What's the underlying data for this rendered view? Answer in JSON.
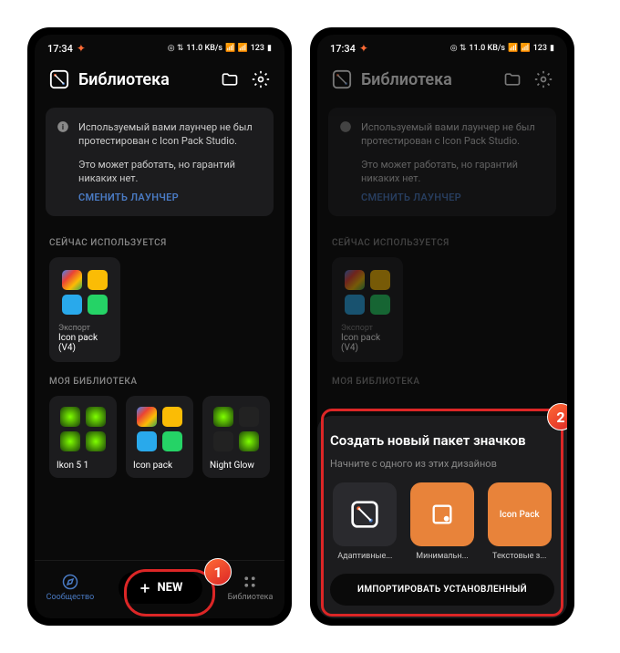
{
  "statusbar": {
    "time": "17:34",
    "speed": "11.0 KB/s",
    "battery": "123"
  },
  "header": {
    "title": "Библиотека"
  },
  "warning": {
    "line1": "Используемый вами лаунчер не был протестирован с Icon Pack Studio.",
    "line2": "Это может работать, но гарантий никаких нет.",
    "link": "СМЕНИТЬ ЛАУНЧЕР"
  },
  "sections": {
    "current": "СЕЙЧАС ИСПОЛЬЗУЕТСЯ",
    "library": "МОЯ БИБЛИОТЕКА"
  },
  "current": {
    "export": "Экспорт",
    "name": "Icon pack (V4)"
  },
  "library": [
    {
      "name": "Ikon 5 1"
    },
    {
      "name": "Icon pack"
    },
    {
      "name": "Night Glow"
    }
  ],
  "nav": {
    "community": "Сообщество",
    "new": "NEW",
    "library": "Библиотека"
  },
  "sheet": {
    "title": "Создать новый пакет значков",
    "subtitle": "Начните с одного из этих дизайнов",
    "designs": [
      {
        "label": "Адаптивные..."
      },
      {
        "label": "Минимальн..."
      },
      {
        "label": "Текстовые з...",
        "box": "Icon Pack"
      }
    ],
    "import": "ИМПОРТИРОВАТЬ УСТАНОВЛЕННЫЙ"
  },
  "badges": {
    "one": "1",
    "two": "2"
  }
}
